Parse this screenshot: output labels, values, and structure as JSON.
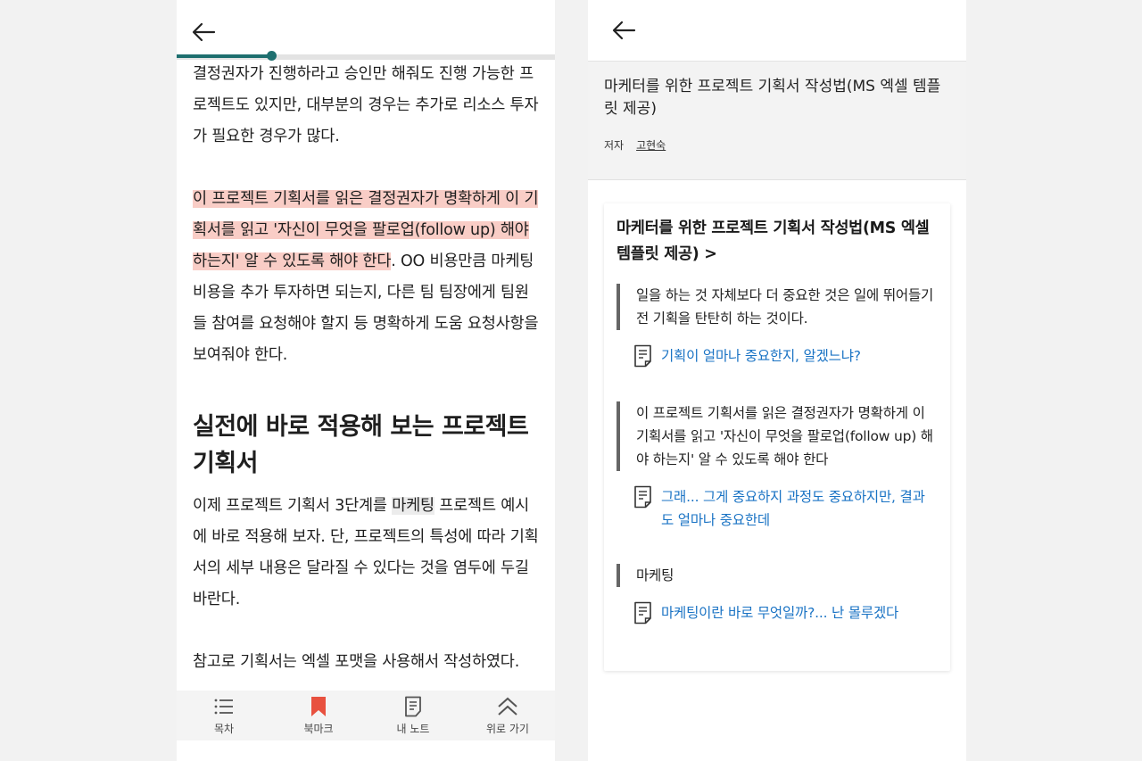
{
  "left": {
    "progress": 0.25,
    "paragraphs": {
      "p1": "결정권자가 진행하라고 승인만 해줘도 진행 가능한 프로젝트도 있지만, 대부분의 경우는 추가로 리소스 투자가 필요한 경우가 많다.",
      "p2_highlight": "이 프로젝트 기획서를 읽은 결정권자가 명확하게 이 기획서를 읽고 '자신이 무엇을 팔로업(follow up) 해야 하는지' 알 수 있도록 해야 한다",
      "p2_rest": ". OO 비용만큼 마케팅 비용을 추가 투자하면 되는지, 다른 팀 팀장에게 팀원들 참여를 요청해야 할지 등 명확하게 도움 요청사항을 보여줘야 한다.",
      "section_title": "실전에 바로 적용해 보는 프로젝트 기획서",
      "p3_a": "이제 프로젝트 기획서 3단계를 ",
      "p3_term": "마케팅",
      "p3_b": " 프로젝트 예시에 바로 적용해 보자. 단, 프로젝트의 특성에 따라 기획서의 세부 내용은 달라질 수 있다는 것을 염두에 두길 바란다.",
      "p4": "참고로 기획서는 엑셀 포맷을 사용해서 작성하였다."
    },
    "nav": {
      "toc": "목차",
      "bookmark": "북마크",
      "my_notes": "내 노트",
      "go_top": "위로 가기"
    },
    "colors": {
      "progress": "#1e6f6f",
      "highlight": "#f9cdc6",
      "bookmark": "#e8513f"
    }
  },
  "right": {
    "book_title": "마케터를 위한 프로젝트 기획서 작성법(MS 엑셀 템플릿 제공)",
    "author_label": "저자",
    "author_name": "고현숙",
    "card_title": "마케터를 위한 프로젝트 기획서 작성법(MS 엑셀 템플릿 제공) >",
    "notes": [
      {
        "quote": "일을 하는 것 자체보다 더 중요한 것은 일에 뛰어들기 전 기획을 탄탄히 하는 것이다.",
        "memo": "기획이 얼마나 중요한지, 알겠느냐?"
      },
      {
        "quote": "이 프로젝트 기획서를 읽은 결정권자가 명확하게 이 기획서를 읽고 '자신이 무엇을 팔로업(follow up) 해야 하는지' 알 수 있도록 해야 한다",
        "memo": "그래... 그게 중요하지 과정도 중요하지만, 결과도 얼마나 중요한데"
      },
      {
        "quote": "마케팅",
        "memo": "마케팅이란 바로 무엇일까?... 난 몰루겠다"
      }
    ],
    "colors": {
      "link": "#1a73c4"
    }
  }
}
